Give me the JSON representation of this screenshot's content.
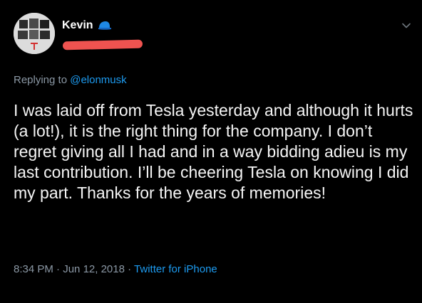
{
  "tweet": {
    "display_name": "Kevin",
    "reply_prefix": "Replying to",
    "reply_handle": "@elonmusk",
    "text": "I was laid off from Tesla yesterday and although it hurts (a lot!), it is the right thing for the company. I don’t regret giving all I had and in a way bidding adieu is my last contribution. I’ll be cheering Tesla on knowing I did my part. Thanks for the years of memories!",
    "time": "8:34 PM",
    "separator": "·",
    "date": "Jun 12, 2018",
    "source": "Twitter for iPhone"
  },
  "icons": {
    "badge": "blue-cap-icon",
    "menu": "chevron-down-icon",
    "avatar": "avatar-photo-collage"
  },
  "colors": {
    "background": "#000000",
    "text": "#f5f5f5",
    "muted": "#8b98a5",
    "link": "#1d9bf0",
    "redaction": "#ef5350"
  }
}
